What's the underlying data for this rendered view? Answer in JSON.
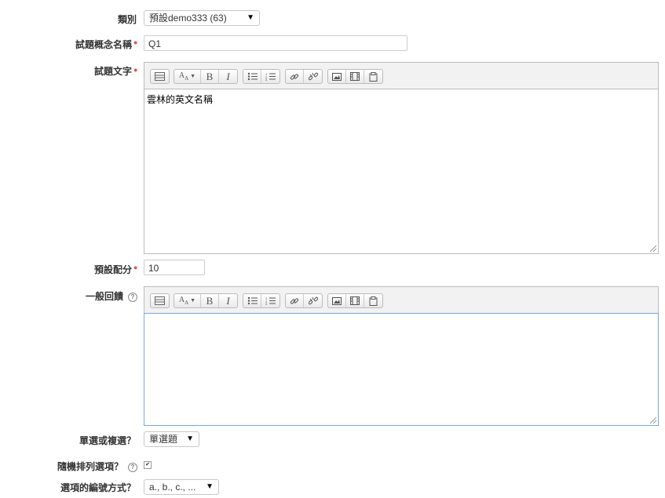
{
  "category": {
    "label": "類別",
    "value": "預設demo333 (63)"
  },
  "question_name": {
    "label": "試題概念名稱",
    "value": "Q1"
  },
  "question_text": {
    "label": "試題文字",
    "content": "雲林的英文名稱"
  },
  "default_mark": {
    "label": "預設配分",
    "value": "10"
  },
  "general_feedback": {
    "label": "一般回饋",
    "content": ""
  },
  "single_multiple": {
    "label": "單選或複選？",
    "value": "單選題"
  },
  "shuffle": {
    "label": "隨機排列選項？",
    "checked": true
  },
  "numbering": {
    "label": "選項的編號方式？",
    "value": "a., b., c., ..."
  },
  "toolbar": {
    "bold": "B",
    "italic": "I"
  },
  "icons": {
    "required": "required-star-icon",
    "help": "help-question-icon"
  },
  "colors": {
    "required": "#d9534f",
    "focus_border": "#7aa7d6"
  }
}
